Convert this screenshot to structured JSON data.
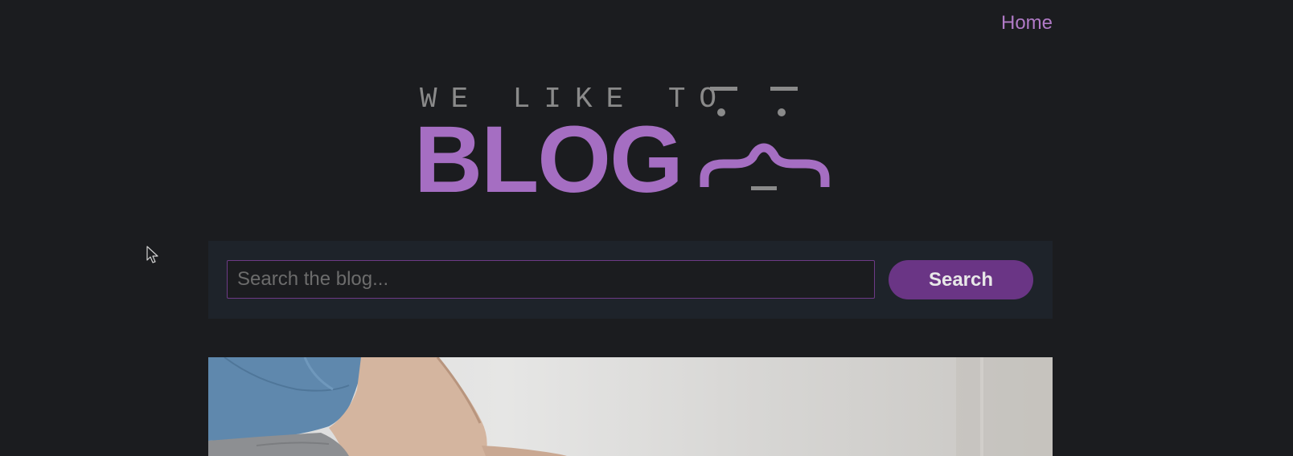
{
  "nav": {
    "home_label": "Home"
  },
  "logo": {
    "tagline": "WE LIKE TO",
    "word": "BLOG"
  },
  "search": {
    "placeholder": "Search the blog...",
    "value": "",
    "button_label": "Search"
  },
  "colors": {
    "background": "#1b1c1f",
    "accent": "#a56ec2",
    "button": "#6a3585",
    "panel": "#1e232a"
  },
  "icons": {
    "cursor": "mouse-pointer-icon",
    "logo_face": "face-icon"
  }
}
